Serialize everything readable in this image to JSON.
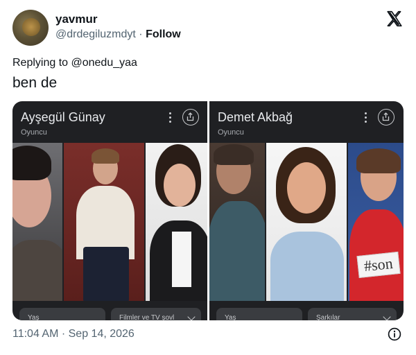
{
  "tweet": {
    "display_name": "yavmur",
    "handle": "@drdegiluzmdyt",
    "separator": "·",
    "follow_label": "Follow",
    "replying_to": "Replying to @onedu_yaa",
    "text": "ben de",
    "timestamp": "11:04 AM · Sep 14, 2026"
  },
  "icons": {
    "brand": "x-logo-icon",
    "info": "info-icon",
    "share": "share-icon",
    "more": "more-vertical-icon"
  },
  "cards": [
    {
      "title": "Ayşegül Günay",
      "subtitle": "Oyuncu",
      "chips": [
        "Yaş",
        "Filmler ve TV şovl"
      ]
    },
    {
      "title": "Demet Akbağ",
      "subtitle": "Oyuncu",
      "chips": [
        "Yaş",
        "Şarkılar"
      ]
    }
  ],
  "sign_text": "#son",
  "colors": {
    "text_primary": "#0f1419",
    "text_secondary": "#536471",
    "card_bg": "#1f2023"
  }
}
